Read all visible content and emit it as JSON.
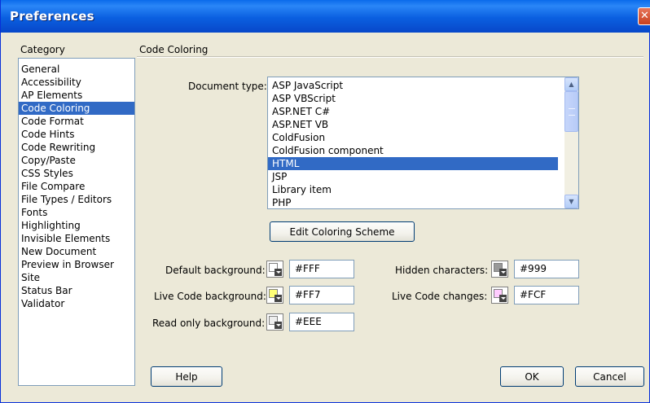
{
  "window": {
    "title": "Preferences"
  },
  "category": {
    "heading": "Category",
    "items": [
      "General",
      "Accessibility",
      "AP Elements",
      "Code Coloring",
      "Code Format",
      "Code Hints",
      "Code Rewriting",
      "Copy/Paste",
      "CSS Styles",
      "File Compare",
      "File Types / Editors",
      "Fonts",
      "Highlighting",
      "Invisible Elements",
      "New Document",
      "Preview in Browser",
      "Site",
      "Status Bar",
      "Validator"
    ],
    "selected_index": 3
  },
  "panel": {
    "heading": "Code Coloring",
    "document_type_label": "Document type:",
    "document_types": [
      "ASP JavaScript",
      "ASP VBScript",
      "ASP.NET C#",
      "ASP.NET VB",
      "ColdFusion",
      "ColdFusion component",
      "HTML",
      "JSP",
      "Library item",
      "PHP"
    ],
    "selected_document_type_index": 6,
    "edit_scheme_button": "Edit Coloring Scheme",
    "colors": {
      "default_background": {
        "label": "Default background:",
        "value": "#FFF",
        "swatch": "#ffffff"
      },
      "live_code_background": {
        "label": "Live Code background:",
        "value": "#FF7",
        "swatch": "#ffff77"
      },
      "read_only_background": {
        "label": "Read only background:",
        "value": "#EEE",
        "swatch": "#eeeeee"
      },
      "hidden_characters": {
        "label": "Hidden characters:",
        "value": "#999",
        "swatch": "#999999"
      },
      "live_code_changes": {
        "label": "Live Code changes:",
        "value": "#FCF",
        "swatch": "#ffccff"
      }
    }
  },
  "buttons": {
    "help": "Help",
    "ok": "OK",
    "cancel": "Cancel"
  },
  "icons": {
    "close": "close-icon",
    "scroll_up": "chevron-up-icon",
    "scroll_down": "chevron-down-icon",
    "dropdown": "dropdown-arrow-icon"
  },
  "accent_colors": {
    "titlebar": "#0a5fe0",
    "selection": "#316ac5",
    "dialog_bg": "#ece9d8"
  }
}
